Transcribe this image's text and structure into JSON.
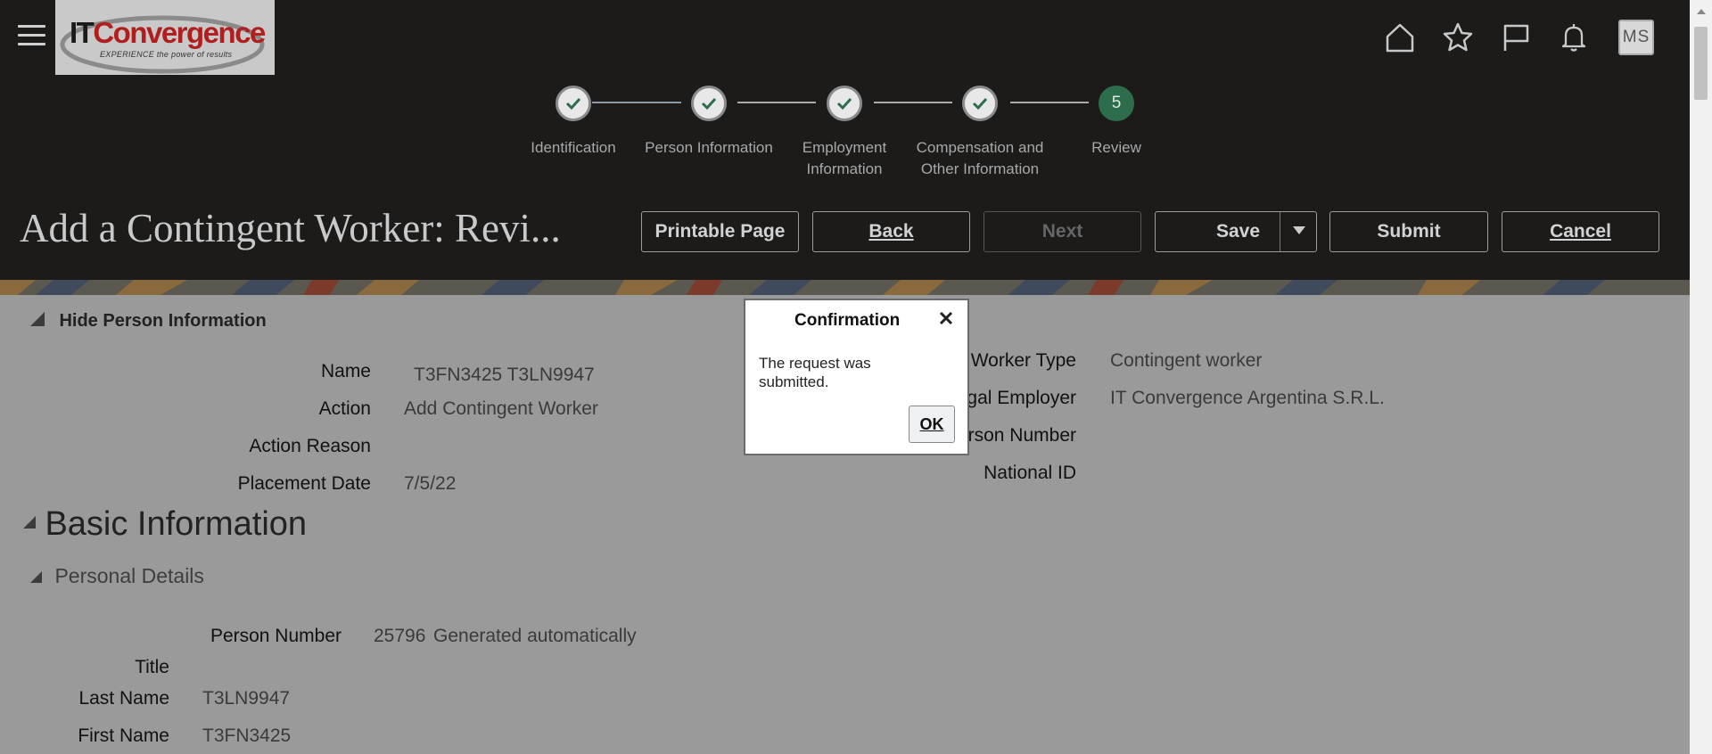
{
  "header": {
    "logo_text_a": "IT",
    "logo_text_b": "Convergence",
    "logo_tagline": "EXPERIENCE the power of results",
    "avatar_initials": "MS",
    "icons": [
      "home-icon",
      "star-icon",
      "flag-icon",
      "bell-icon"
    ]
  },
  "train": {
    "stops": [
      {
        "label": "Identification",
        "done": true
      },
      {
        "label": "Person Information",
        "done": true
      },
      {
        "label": "Employment Information",
        "done": true
      },
      {
        "label": "Compensation and Other Information",
        "done": true
      },
      {
        "label": "Review",
        "number": "5",
        "current": true
      }
    ]
  },
  "page": {
    "title": "Add a Contingent Worker: Revi..."
  },
  "buttons": {
    "printable": "Printable Page",
    "back": "Back",
    "next": "Next",
    "save": "Save",
    "submit": "Submit",
    "cancel": "Cancel"
  },
  "person_info": {
    "toggle_label": "Hide Person Information",
    "left": [
      {
        "label": "Name",
        "value": "T3FN3425 T3LN9947"
      },
      {
        "label": "Action",
        "value": "Add Contingent Worker"
      },
      {
        "label": "Action Reason",
        "value": ""
      },
      {
        "label": "Placement Date",
        "value": "7/5/22"
      }
    ],
    "right": [
      {
        "label": "Worker Type",
        "value": "Contingent worker"
      },
      {
        "label": "Legal Employer",
        "value": "IT Convergence Argentina S.R.L."
      },
      {
        "label": "Person Number",
        "value": ""
      },
      {
        "label": "National ID",
        "value": ""
      }
    ]
  },
  "basic_info": {
    "heading": "Basic Information",
    "personal_details_heading": "Personal Details",
    "person_number_label": "Person Number",
    "person_number_value": "25796",
    "person_number_note": "Generated automatically",
    "title_label": "Title",
    "title_value": "",
    "last_name_label": "Last Name",
    "last_name_value": "T3LN9947",
    "first_name_label": "First Name",
    "first_name_value": "T3FN3425"
  },
  "dialog": {
    "title": "Confirmation",
    "message": "The request was submitted.",
    "ok_label": "OK"
  },
  "colors": {
    "header_bg": "#1c1b1a",
    "train_current": "#2d6d4b",
    "overlay": "#9a9a9a"
  }
}
